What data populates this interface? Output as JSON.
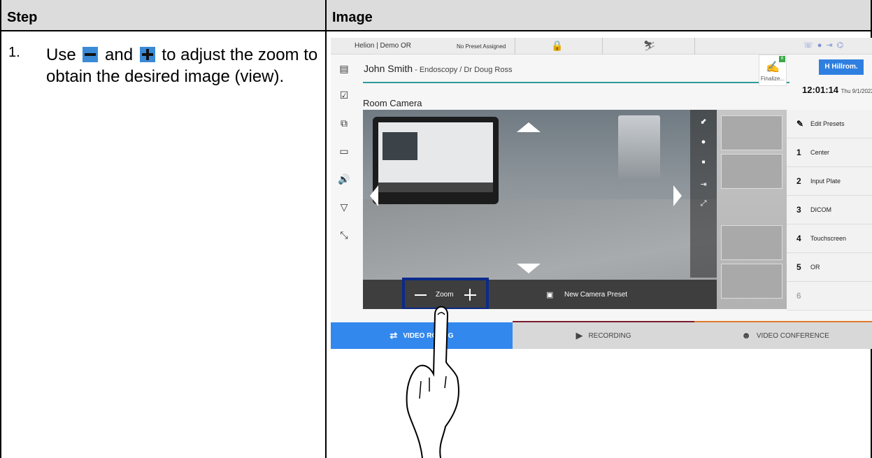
{
  "table": {
    "header_step": "Step",
    "header_image": "Image"
  },
  "step": {
    "number": "1.",
    "text_before": "Use",
    "text_and": "and",
    "text_after": "to adjust the zoom to obtain the desired image (view)."
  },
  "screen": {
    "location": "Helion | Demo OR",
    "preset_status": "No Preset Assigned",
    "patient_name": "John Smith",
    "patient_detail": " - Endoscopy / Dr Doug Ross",
    "finalize_label": "Finalize...",
    "finalize_badge": "6",
    "brand_label": "Hillrom.",
    "brand_mark": "H",
    "clock_time": "12:01:14",
    "clock_date": "Thu 9/1/2022",
    "room_camera_title": "Room Camera",
    "zoom_label": "Zoom",
    "new_preset_label": "New Camera Preset",
    "presets": [
      {
        "num": "",
        "name": "Edit Presets"
      },
      {
        "num": "1",
        "name": "Center"
      },
      {
        "num": "2",
        "name": "Input Plate"
      },
      {
        "num": "3",
        "name": "DICOM"
      },
      {
        "num": "4",
        "name": "Touchscreen"
      },
      {
        "num": "5",
        "name": "OR"
      },
      {
        "num": "6",
        "name": ""
      }
    ],
    "tabs": [
      {
        "label": "VIDEO ROU...G"
      },
      {
        "label": "RECORDING"
      },
      {
        "label": "VIDEO CONFERENCE"
      }
    ]
  },
  "colors": {
    "accent_blue": "#3388ee",
    "highlight_box": "#0b2a8a",
    "header_gray": "#dcdcdc",
    "patient_line": "#2f9b9b"
  }
}
